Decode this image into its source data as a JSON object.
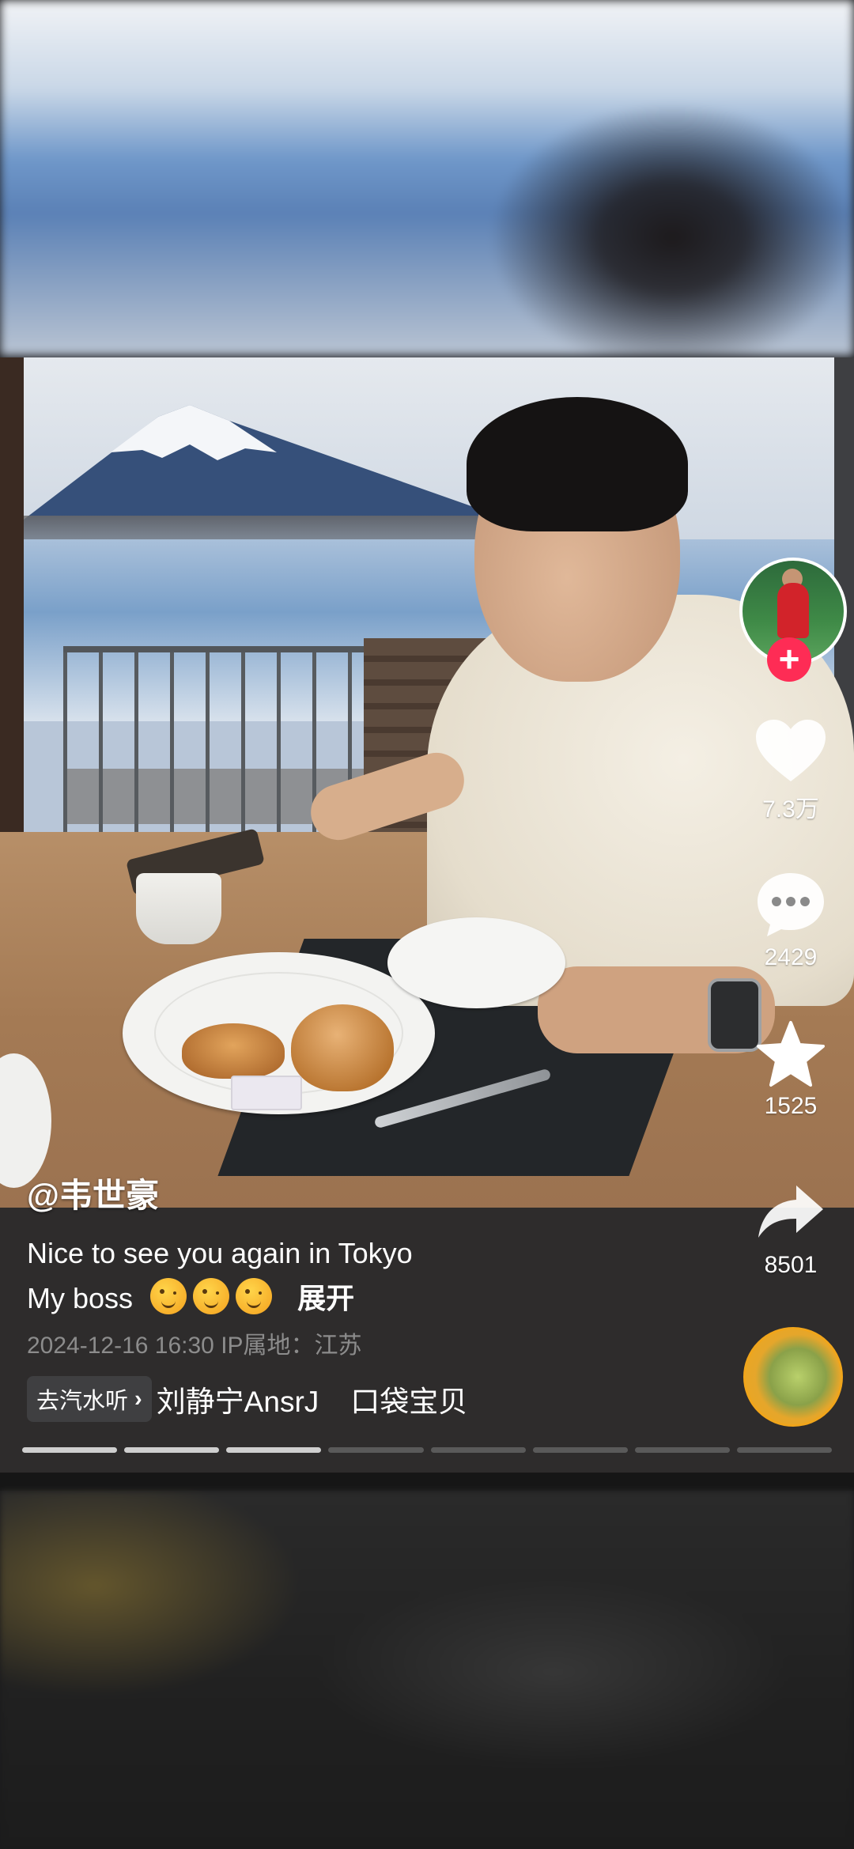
{
  "video": {
    "author": "@韦世豪",
    "caption_line1": "Nice to see you again in Tokyo",
    "caption_line2": "My boss",
    "expand_label": "展开",
    "date_location": "2024-12-16 16:30  IP属地：江苏",
    "music_button_label": "去汽水听",
    "music_info": "刘静宁AnsrJ",
    "music_title": "口袋宝贝",
    "progress": {
      "total_segments": 8,
      "completed_segments": 3
    }
  },
  "sidebar": {
    "follow_label": "+",
    "like_count": "7.3万",
    "comment_count": "2429",
    "favorite_count": "1525",
    "share_count": "8501"
  },
  "colors": {
    "accent": "#fe2c55",
    "panel_bg": "#2e2c2c",
    "meta_text": "#8c8c8c"
  },
  "icons": [
    "heart-icon",
    "comment-icon",
    "star-icon",
    "share-icon",
    "music-disc-icon",
    "chevron-right-icon",
    "plus-icon"
  ]
}
